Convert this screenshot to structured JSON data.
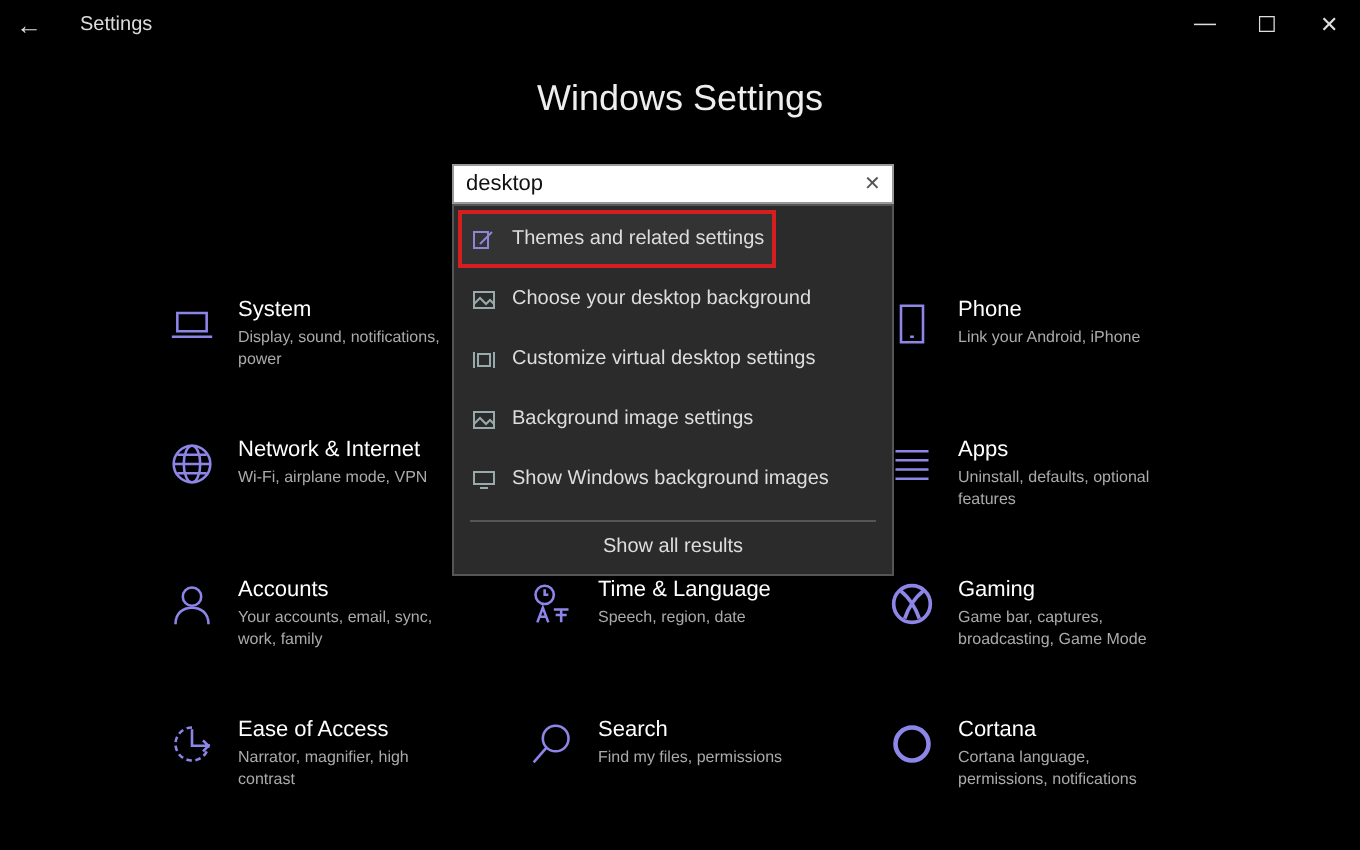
{
  "window": {
    "title": "Settings",
    "back": "←",
    "controls": [
      "—",
      "☐",
      "✕"
    ]
  },
  "heading": "Windows Settings",
  "search": {
    "value": "desktop",
    "clear": "✕"
  },
  "suggestions": [
    {
      "label": "Themes and related settings",
      "kind": "themes",
      "selected": true
    },
    {
      "label": "Choose your desktop background",
      "kind": "picture",
      "selected": false
    },
    {
      "label": "Customize virtual desktop settings",
      "kind": "virtual",
      "selected": false
    },
    {
      "label": "Background image settings",
      "kind": "picture",
      "selected": false
    },
    {
      "label": "Show Windows background images",
      "kind": "monitor",
      "selected": false
    }
  ],
  "show_all": "Show all results",
  "tiles": [
    {
      "title": "System",
      "description": "Display, sound, notifications, power",
      "kind": "laptop"
    },
    {
      "title": "Phone",
      "description": "Link your Android, iPhone",
      "kind": "phone"
    },
    {
      "title": "Network & Internet",
      "description": "Wi-Fi, airplane mode, VPN",
      "kind": "globe"
    },
    {
      "title": "Apps",
      "description": "Uninstall, defaults, optional features",
      "kind": "apps"
    },
    {
      "title": "Accounts",
      "description": "Your accounts, email, sync, work, family",
      "kind": "person"
    },
    {
      "title": "Time & Language",
      "description": "Speech, region, date",
      "kind": "time"
    },
    {
      "title": "Gaming",
      "description": "Game bar, captures, broadcasting, Game Mode",
      "kind": "xbox"
    },
    {
      "title": "Ease of Access",
      "description": "Narrator, magnifier, high contrast",
      "kind": "ease"
    },
    {
      "title": "Search",
      "description": "Find my files, permissions",
      "kind": "search"
    },
    {
      "title": "Cortana",
      "description": "Cortana language, permissions, notifications",
      "kind": "ring"
    }
  ]
}
